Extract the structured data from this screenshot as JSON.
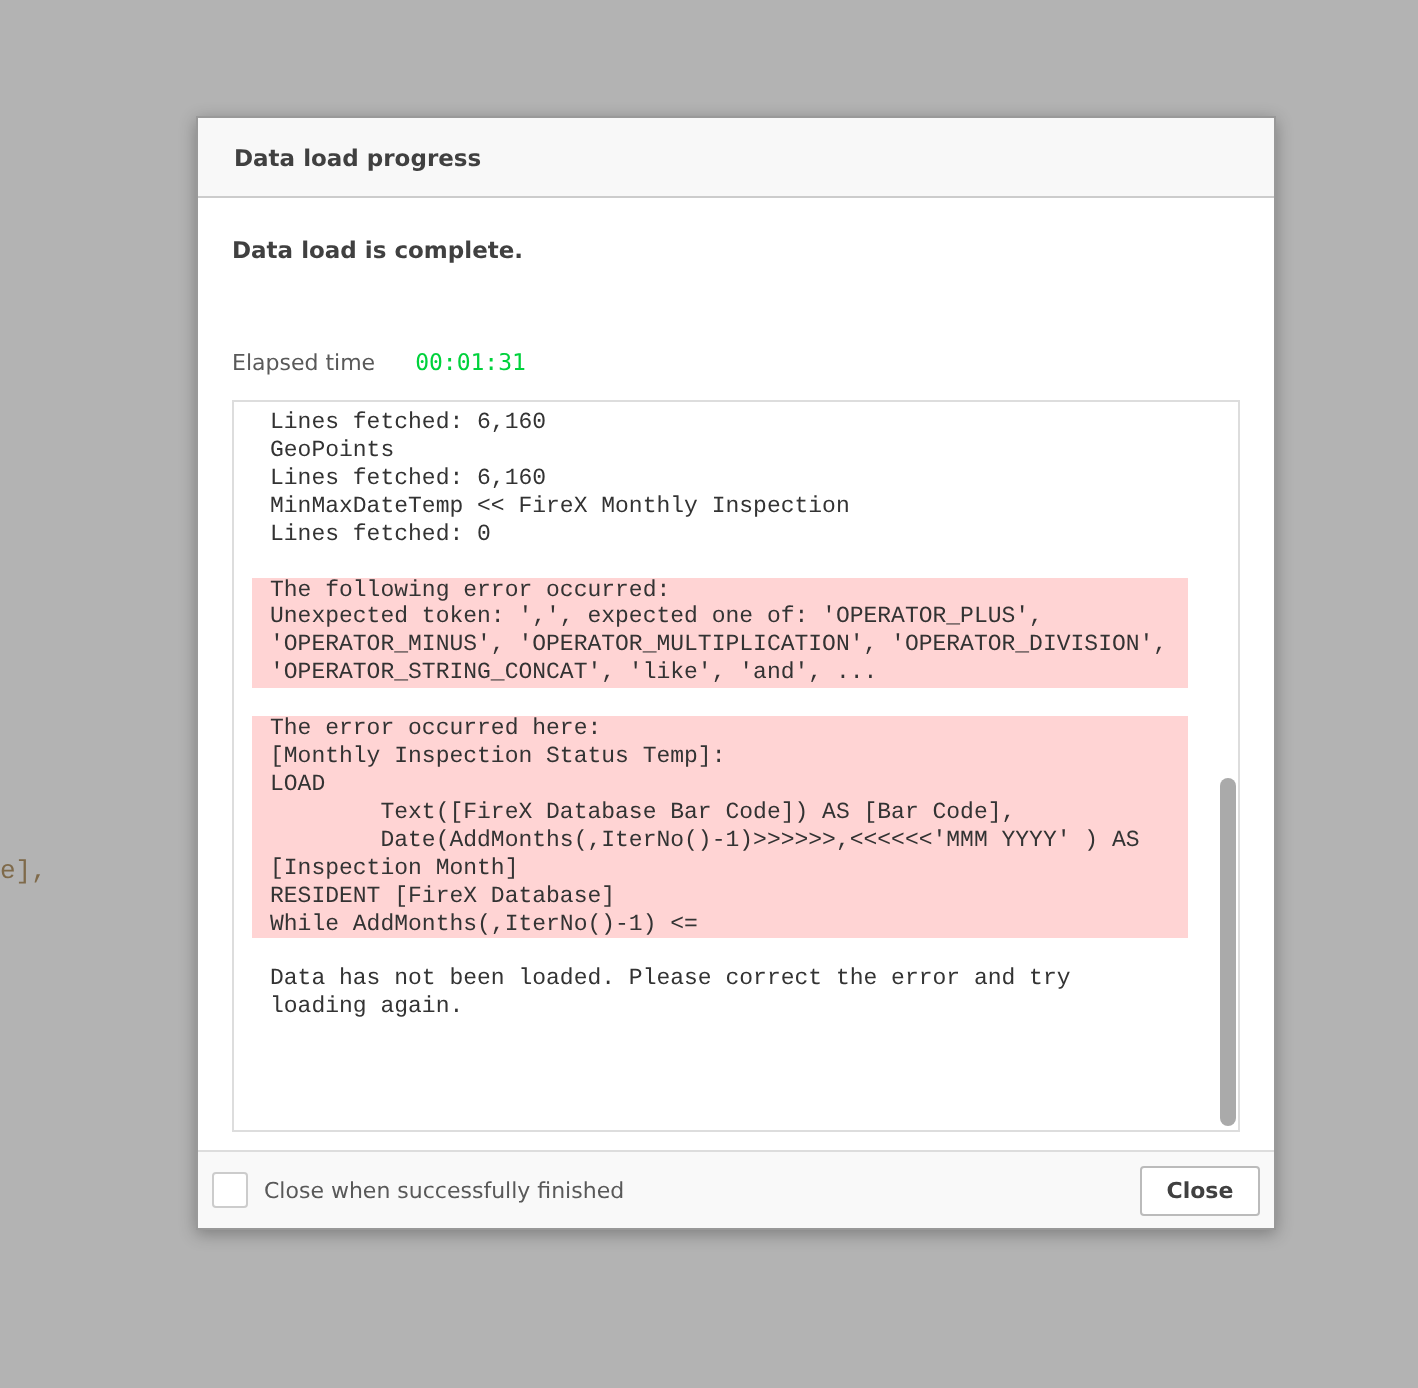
{
  "background": {
    "code_fragment": "e],"
  },
  "dialog": {
    "title": "Data load progress",
    "status": "Data load is complete.",
    "elapsed": {
      "label": "Elapsed time",
      "value": "00:01:31"
    },
    "log": [
      {
        "kind": "plain",
        "lines": [
          "Lines fetched: 6,160",
          "GeoPoints",
          "Lines fetched: 6,160",
          "MinMaxDateTemp << FireX Monthly Inspection",
          "Lines fetched: 0"
        ]
      },
      {
        "kind": "error",
        "lines": [
          "The following error occurred:",
          "Unexpected token: ',', expected one of: 'OPERATOR_PLUS',",
          "'OPERATOR_MINUS', 'OPERATOR_MULTIPLICATION', 'OPERATOR_DIVISION',",
          "'OPERATOR_STRING_CONCAT', 'like', 'and', ..."
        ]
      },
      {
        "kind": "error",
        "lines": [
          "The error occurred here:",
          "[Monthly Inspection Status Temp]:",
          "LOAD",
          "        Text([FireX Database Bar Code]) AS [Bar Code],",
          "        Date(AddMonths(,IterNo()-1)>>>>>>,<<<<<<'MMM YYYY' ) AS",
          "[Inspection Month]",
          "RESIDENT [FireX Database]",
          "While AddMonths(,IterNo()-1) <="
        ]
      },
      {
        "kind": "plain",
        "lines": [
          "Data has not been loaded. Please correct the error and try",
          "loading again."
        ]
      }
    ],
    "close_when_finished": {
      "label": "Close when successfully finished",
      "checked": false
    },
    "close_button": "Close"
  }
}
